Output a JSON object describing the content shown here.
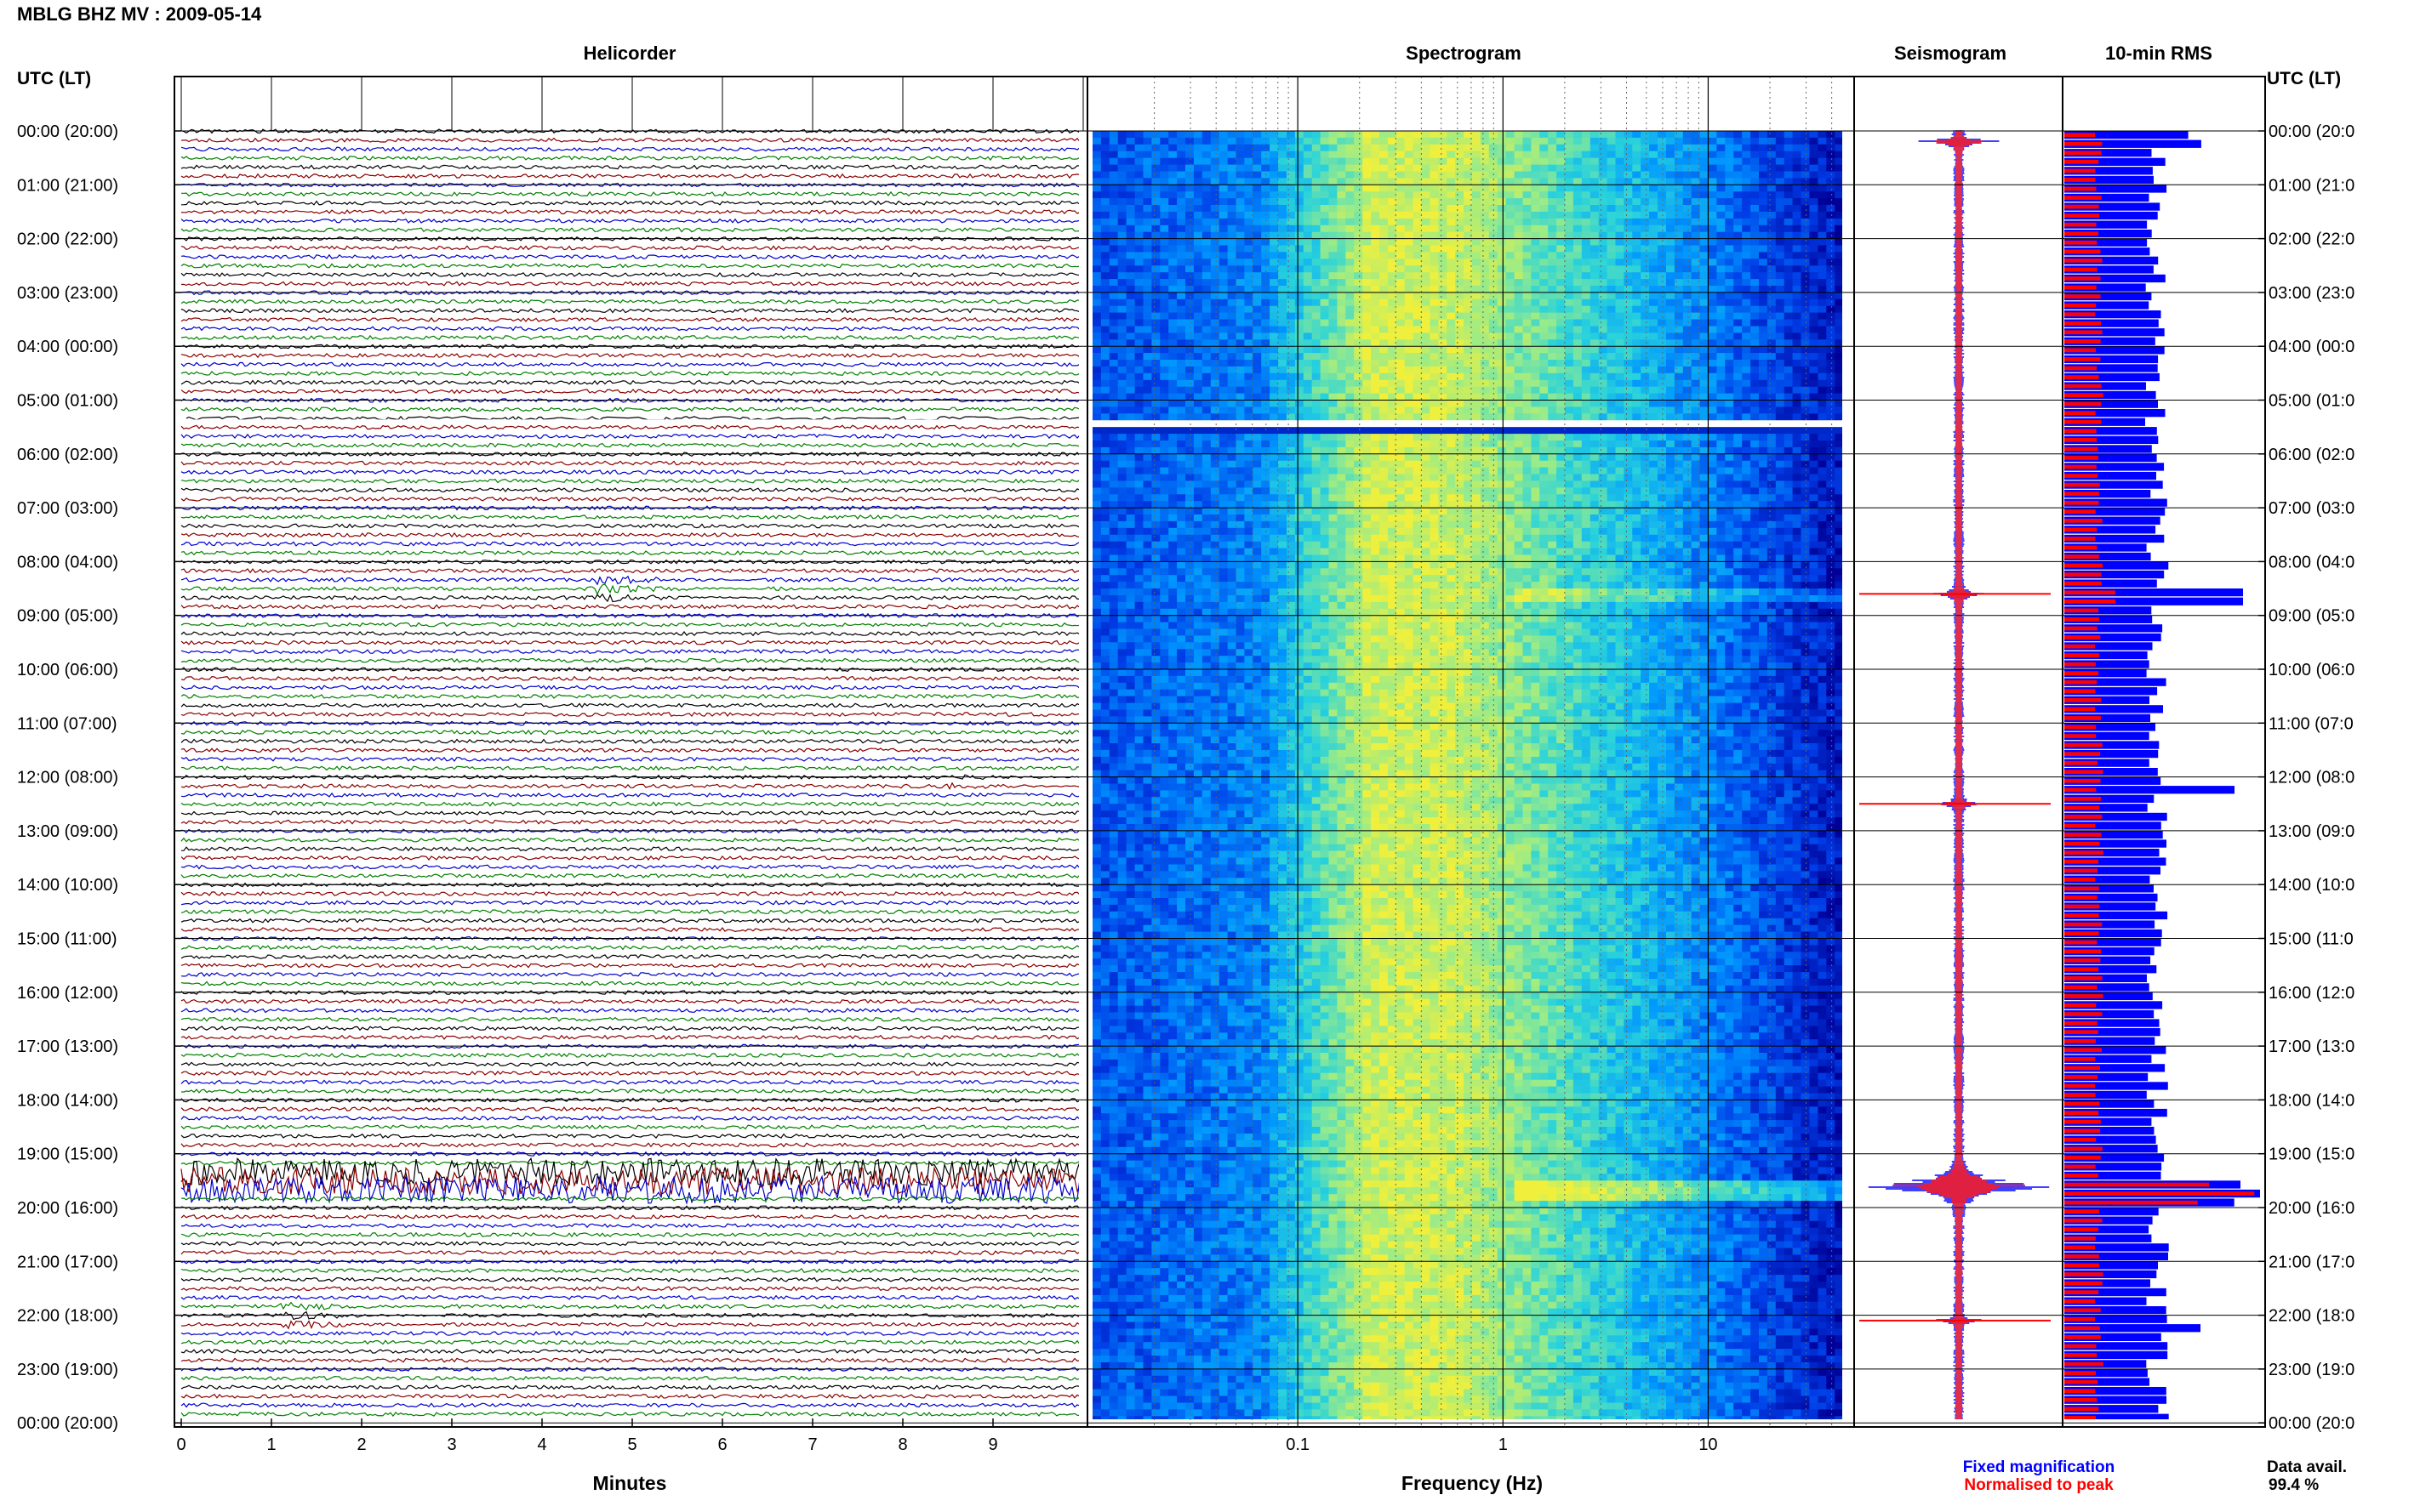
{
  "header": {
    "title": "MBLG BHZ MV : 2009-05-14",
    "utc_label": "UTC (LT)",
    "utc_label_right": "UTC (LT)"
  },
  "panels": {
    "helicorder": "Helicorder",
    "spectrogram": "Spectrogram",
    "seismogram": "Seismogram",
    "rms": "10-min RMS"
  },
  "hour_labels": [
    "00:00 (20:00)",
    "01:00 (21:00)",
    "02:00 (22:00)",
    "03:00 (23:00)",
    "04:00 (00:00)",
    "05:00 (01:00)",
    "06:00 (02:00)",
    "07:00 (03:00)",
    "08:00 (04:00)",
    "09:00 (05:00)",
    "10:00 (06:00)",
    "11:00 (07:00)",
    "12:00 (08:00)",
    "13:00 (09:00)",
    "14:00 (10:00)",
    "15:00 (11:00)",
    "16:00 (12:00)",
    "17:00 (13:00)",
    "18:00 (14:00)",
    "19:00 (15:00)",
    "20:00 (16:00)",
    "21:00 (17:00)",
    "22:00 (18:00)",
    "23:00 (19:00)",
    "00:00 (20:00)"
  ],
  "hour_labels_right": [
    "00:00 (20:0",
    "01:00 (21:0",
    "02:00 (22:0",
    "03:00 (23:0",
    "04:00 (00:0",
    "05:00 (01:0",
    "06:00 (02:0",
    "07:00 (03:0",
    "08:00 (04:0",
    "09:00 (05:0",
    "10:00 (06:0",
    "11:00 (07:0",
    "12:00 (08:0",
    "13:00 (09:0",
    "14:00 (10:0",
    "15:00 (11:0",
    "16:00 (12:0",
    "17:00 (13:0",
    "18:00 (14:0",
    "19:00 (15:0",
    "20:00 (16:0",
    "21:00 (17:0",
    "22:00 (18:0",
    "23:00 (19:0",
    "00:00 (20:0"
  ],
  "footer": {
    "minutes_label": "Minutes",
    "frequency_label": "Frequency (Hz)",
    "legend_fixed": "Fixed magnification",
    "legend_normalised": "Normalised to peak",
    "data_avail_label": "Data avail.",
    "data_avail_value": "99.4 %"
  },
  "colors": {
    "trace_cycle": [
      "#000000",
      "#8b0000",
      "#0000cd",
      "#008000"
    ],
    "fixed": "#0000ff",
    "normalised": "#ff0000",
    "grid": "#000000"
  },
  "chart_data": [
    {
      "type": "line",
      "name": "helicorder",
      "xlabel": "Minutes",
      "x_ticks": [
        "0",
        "1",
        "2",
        "3",
        "4",
        "5",
        "6",
        "7",
        "8",
        "9"
      ],
      "xlim": [
        0,
        10
      ],
      "hours": 24,
      "lines_per_hour": 6,
      "data_gap_hours": [
        5.33,
        5.5
      ],
      "events": [
        {
          "hour": 8.5,
          "minute": 4.6,
          "amplitude": 3
        },
        {
          "hour": 12.1,
          "minute": 8.5,
          "amplitude": 2
        },
        {
          "hour": 19.5,
          "minute": 0,
          "amplitude": 8
        },
        {
          "hour": 22.0,
          "minute": 1.1,
          "amplitude": 3
        }
      ]
    },
    {
      "type": "heatmap",
      "name": "spectrogram",
      "xlabel": "Frequency (Hz)",
      "x_scale": "log",
      "xlim": [
        0.01,
        50
      ],
      "x_ticks": [
        "0.1",
        "1",
        "10"
      ],
      "peak_band_hz": [
        0.2,
        0.35
      ]
    },
    {
      "type": "line",
      "name": "seismogram",
      "series": [
        "Fixed magnification",
        "Normalised to peak"
      ],
      "peaks_hour": [
        0.2,
        8.6,
        12.5,
        19.6,
        22.1
      ]
    },
    {
      "type": "bar",
      "name": "10-min RMS",
      "series": [
        "Fixed magnification",
        "Normalised to peak"
      ],
      "peaks_hour": [
        8.6,
        12.2,
        19.6,
        22.2
      ]
    }
  ]
}
